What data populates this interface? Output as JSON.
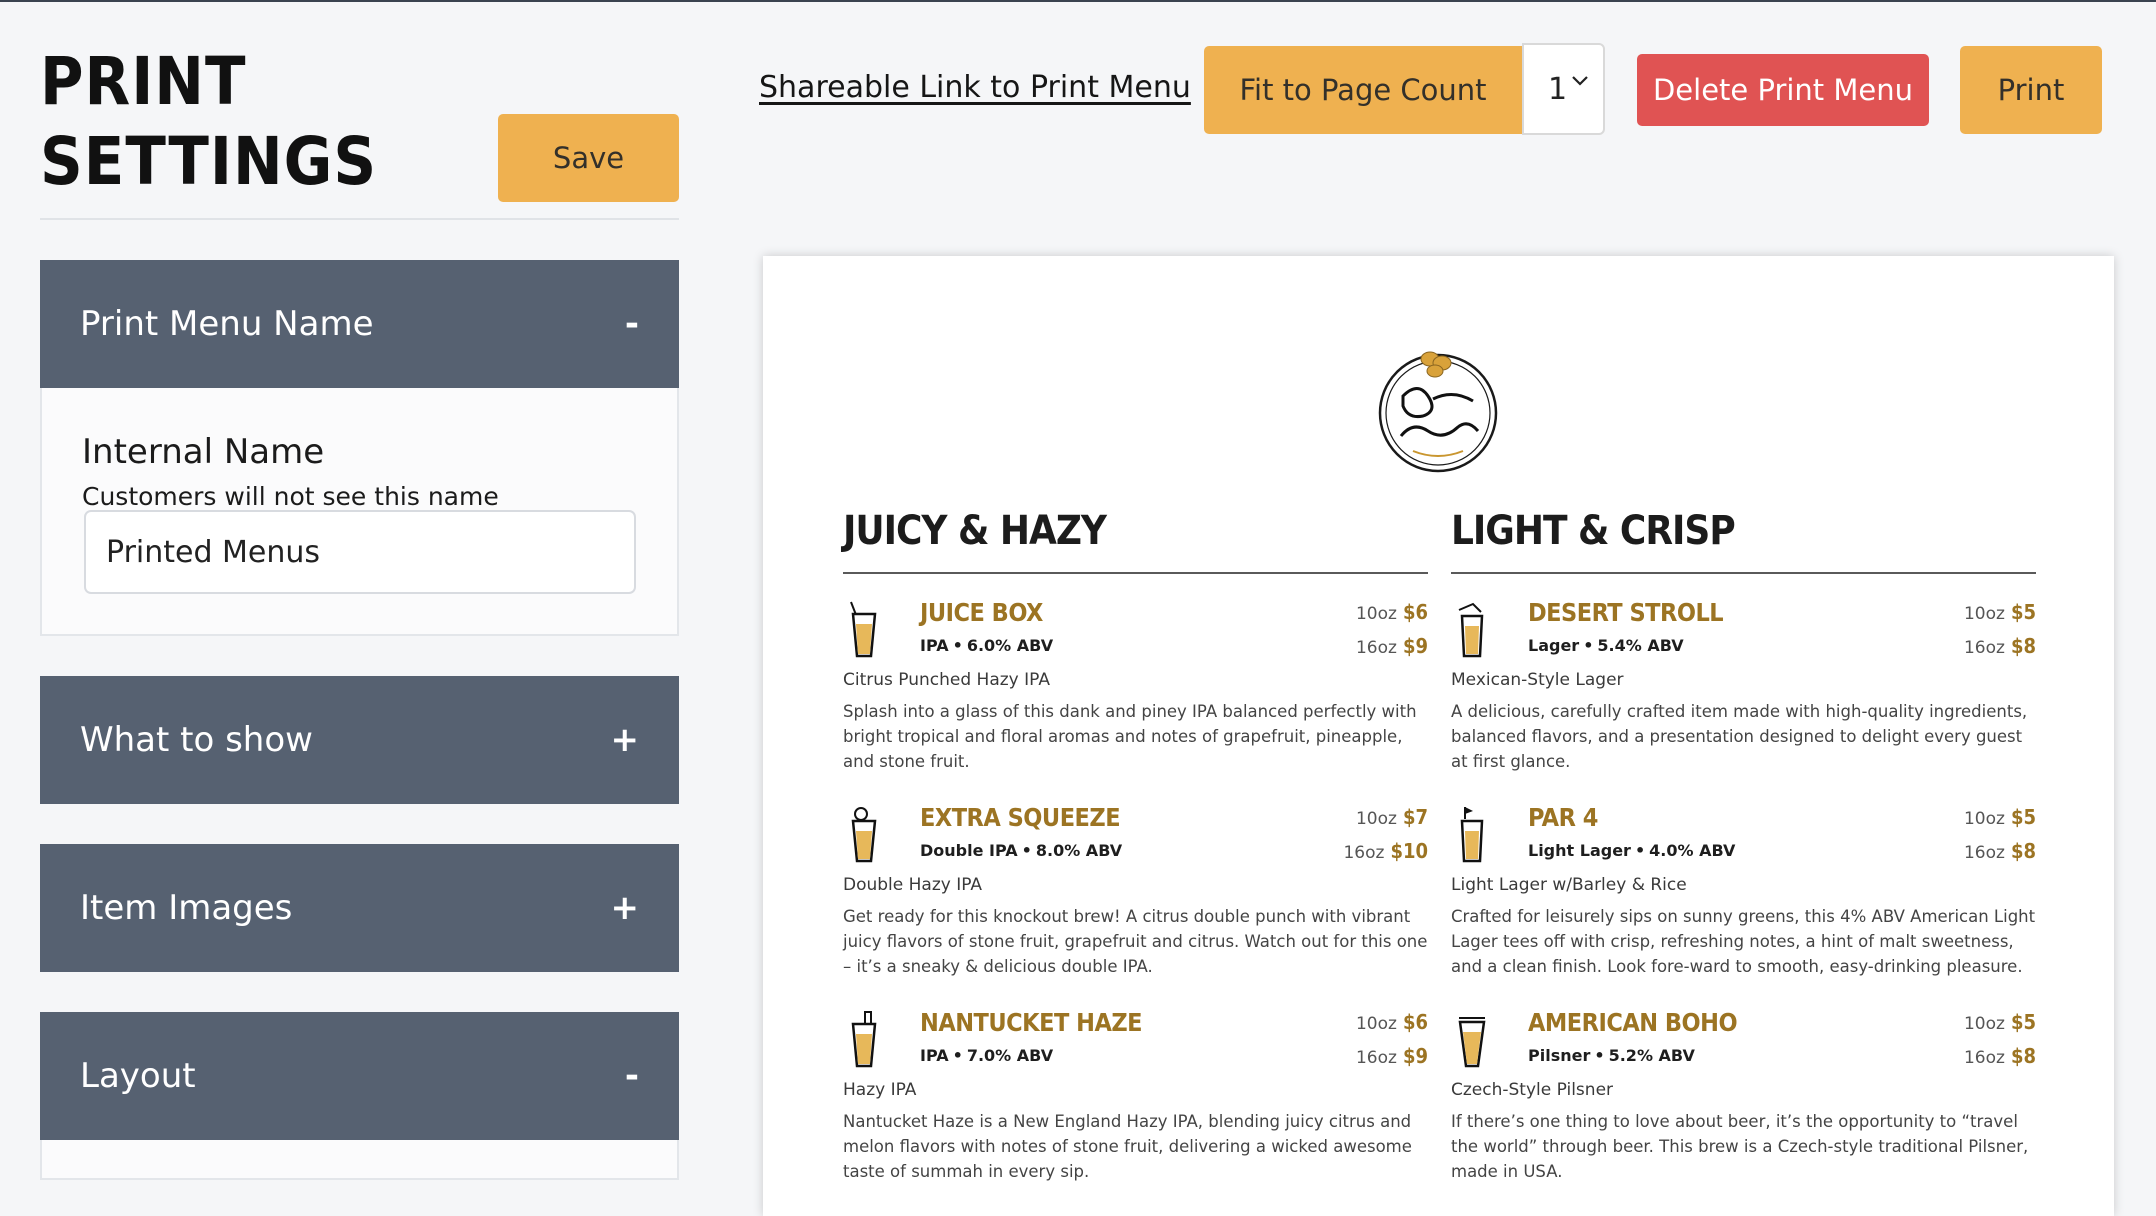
{
  "page": {
    "title_line1": "PRINT",
    "title_line2": "SETTINGS",
    "save_label": "Save"
  },
  "toolbar": {
    "share_link": "Shareable Link to Print Menu",
    "fit_label": "Fit to Page Count",
    "page_count": "1",
    "delete_label": "Delete Print Menu",
    "print_label": "Print"
  },
  "sections": {
    "name": {
      "label": "Print Menu Name",
      "toggle": "-"
    },
    "what": {
      "label": "What to show",
      "toggle": "+"
    },
    "images": {
      "label": "Item Images",
      "toggle": "+"
    },
    "layout": {
      "label": "Layout",
      "toggle": "-"
    }
  },
  "internal_name": {
    "label": "Internal Name",
    "help": "Customers will not see this name",
    "value": "Printed Menus"
  },
  "menu": {
    "logo_alt": "Diamond Spring Brewing Co.",
    "categories": [
      {
        "title": "JUICY & HAZY",
        "items": [
          {
            "name": "JUICE BOX",
            "style": "IPA",
            "abv": "6.0% ABV",
            "size1": "10oz",
            "price1": "$6",
            "size2": "16oz",
            "price2": "$9",
            "sub": "Citrus Punched Hazy IPA",
            "desc": "Splash into a glass of this dank and piney IPA balanced perfectly with bright tropical and floral aromas and notes of grapefruit, pineapple, and stone fruit."
          },
          {
            "name": "EXTRA SQUEEZE",
            "style": "Double IPA",
            "abv": "8.0% ABV",
            "size1": "10oz",
            "price1": "$7",
            "size2": "16oz",
            "price2": "$10",
            "sub": "Double Hazy IPA",
            "desc": "Get ready for this knockout brew! A citrus double punch with vibrant juicy flavors of stone fruit, grapefruit and citrus. Watch out for this one – it’s a sneaky & delicious double IPA."
          },
          {
            "name": "NANTUCKET HAZE",
            "style": "IPA",
            "abv": "7.0% ABV",
            "size1": "10oz",
            "price1": "$6",
            "size2": "16oz",
            "price2": "$9",
            "sub": "Hazy IPA",
            "desc": "Nantucket Haze is a New England Hazy IPA, blending juicy citrus and melon flavors with notes of stone fruit, delivering a wicked awesome taste of summah in every sip."
          }
        ]
      },
      {
        "title": "LIGHT & CRISP",
        "items": [
          {
            "name": "DESERT STROLL",
            "style": "Lager",
            "abv": "5.4% ABV",
            "size1": "10oz",
            "price1": "$5",
            "size2": "16oz",
            "price2": "$8",
            "sub": "Mexican-Style Lager",
            "desc": "A delicious, carefully crafted item made with high-quality ingredients, balanced flavors, and a presentation designed to delight every guest at first glance."
          },
          {
            "name": "PAR 4",
            "style": "Light Lager",
            "abv": "4.0% ABV",
            "size1": "10oz",
            "price1": "$5",
            "size2": "16oz",
            "price2": "$8",
            "sub": "Light Lager w/Barley & Rice",
            "desc": "Crafted for leisurely sips on sunny greens, this 4% ABV American Light Lager tees off with crisp, refreshing notes, a hint of malt sweetness, and a clean finish. Look fore-ward to smooth, easy-drinking pleasure."
          },
          {
            "name": "AMERICAN BOHO",
            "style": "Pilsner",
            "abv": "5.2% ABV",
            "size1": "10oz",
            "price1": "$5",
            "size2": "16oz",
            "price2": "$8",
            "sub": "Czech-Style Pilsner",
            "desc": "If there’s one thing to love about beer, it’s the opportunity to “travel the world” through beer. This brew is a Czech-style traditional Pilsner, made in USA."
          }
        ]
      }
    ]
  },
  "colors": {
    "accent_amber": "#efb150",
    "danger_red": "#e05353",
    "accordion_slate": "#566171",
    "price_gold": "#9c7423"
  }
}
